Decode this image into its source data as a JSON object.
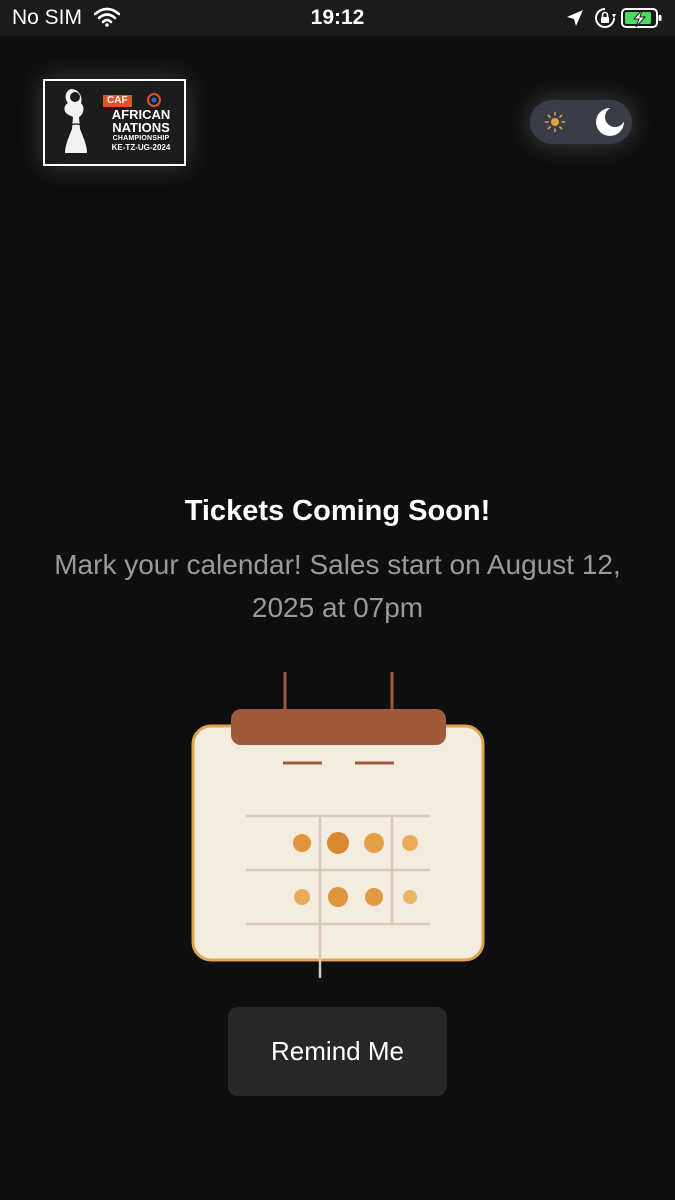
{
  "status_bar": {
    "carrier": "No SIM",
    "time": "19:12",
    "icons": [
      "wifi-icon",
      "location-arrow-icon",
      "rotation-lock-icon",
      "battery-charging-icon"
    ]
  },
  "logo": {
    "caf": "CAF",
    "line1": "AFRICAN",
    "line2": "NATIONS",
    "line3": "CHAMPIONSHIP",
    "line4": "KE-TZ-UG-2024"
  },
  "theme_toggle": {
    "icons": [
      "sun-icon",
      "moon-icon"
    ],
    "selected": "dark"
  },
  "main": {
    "headline": "Tickets Coming Soon!",
    "subtext": "Mark your calendar! Sales start on August 12, 2025 at 07pm",
    "button_label": "Remind Me"
  },
  "colors": {
    "background": "#0d0e10",
    "calendar_header": "#a0593a",
    "calendar_body": "#f5ece0",
    "calendar_border": "#e0a24a",
    "dot_orange": "#e0963a",
    "button_bg": "#262728"
  }
}
